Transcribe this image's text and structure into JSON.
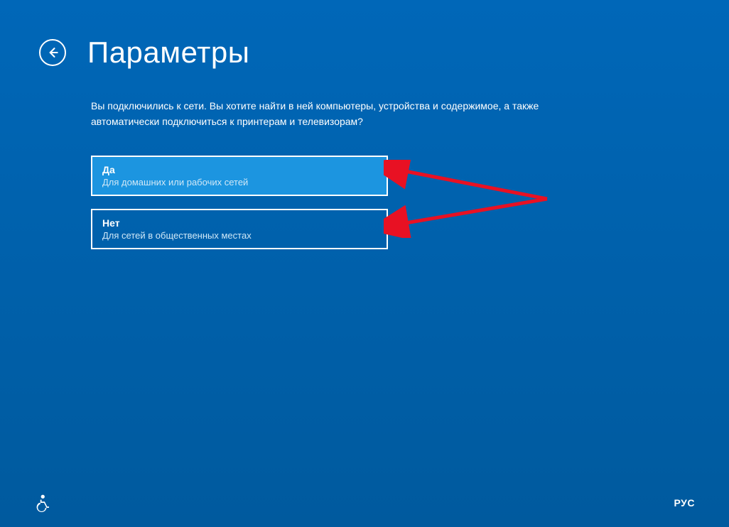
{
  "header": {
    "title": "Параметры"
  },
  "content": {
    "description": "Вы подключились к сети. Вы хотите найти в ней компьютеры, устройства и содержимое, а также автоматически подключиться к принтерам и телевизорам?"
  },
  "options": [
    {
      "title": "Да",
      "subtitle": "Для домашних или рабочих сетей",
      "selected": true
    },
    {
      "title": "Нет",
      "subtitle": "Для сетей в общественных местах",
      "selected": false
    }
  ],
  "footer": {
    "language": "РУС"
  }
}
